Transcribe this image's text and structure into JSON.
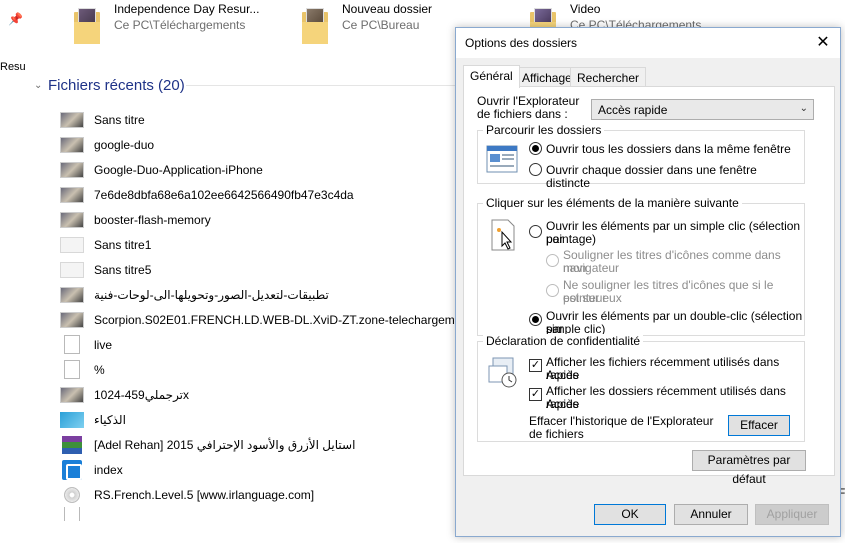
{
  "explorer": {
    "left_label": "Resu",
    "top_items": [
      {
        "name": "Independence Day Resur...",
        "location": "Ce PC\\Téléchargements"
      },
      {
        "name": "Nouveau dossier",
        "location": "Ce PC\\Bureau"
      },
      {
        "name": "Video",
        "location": "Ce PC\\Téléchargements"
      }
    ],
    "recent_header": "Fichiers récents (20)",
    "recent_files": [
      {
        "name": "Sans titre",
        "icon": "image-thumb-icon"
      },
      {
        "name": "google-duo",
        "icon": "image-thumb-icon"
      },
      {
        "name": "Google-Duo-Application-iPhone",
        "icon": "image-thumb-icon"
      },
      {
        "name": "7e6de8dbfa68e6a102ee6642566490fb47e3c4da",
        "icon": "image-thumb-icon"
      },
      {
        "name": "booster-flash-memory",
        "icon": "image-thumb-icon"
      },
      {
        "name": "Sans titre1",
        "icon": "blank-image-icon"
      },
      {
        "name": "Sans titre5",
        "icon": "blank-image-icon"
      },
      {
        "name": "تطبيقات-لتعديل-الصور-وتحويلها-الى-لوحات-فنية",
        "icon": "image-thumb-icon"
      },
      {
        "name": "Scorpion.S02E01.FRENCH.LD.WEB-DL.XviD-ZT.zone-telechargement.",
        "icon": "video-thumb-icon"
      },
      {
        "name": "live",
        "icon": "document-icon"
      },
      {
        "name": "%",
        "icon": "document-icon"
      },
      {
        "name": "1024-ترجملي459x",
        "icon": "image-thumb-icon"
      },
      {
        "name": "الذكياء",
        "icon": "tile-image-icon"
      },
      {
        "name": "[Adel Rehan] 2015 استايل الأزرق والأسود الإحترافي",
        "icon": "rar-archive-icon"
      },
      {
        "name": "index",
        "icon": "app-icon"
      },
      {
        "name": "RS.French.Level.5 [www.irlanguage.com]",
        "icon": "disc-image-icon"
      }
    ],
    "right_fragment": "F"
  },
  "dialog": {
    "title": "Options des dossiers",
    "close_symbol": "✕",
    "tabs": [
      "Général",
      "Affichage",
      "Rechercher"
    ],
    "open_explorer": {
      "label_line1": "Ouvrir l'Explorateur",
      "label_line2": "de fichiers dans :",
      "selected": "Accès rapide",
      "arrow": "⌄"
    },
    "browse_group": {
      "title": "Parcourir les dossiers",
      "options": [
        {
          "label": "Ouvrir tous les dossiers dans la même fenêtre",
          "checked": true
        },
        {
          "label": "Ouvrir chaque dossier dans une fenêtre distincte",
          "checked": false
        }
      ]
    },
    "click_group": {
      "title": "Cliquer sur les éléments de la manière suivante",
      "single_click_line1": "Ouvrir les éléments par un simple clic (sélection par",
      "single_click_line2": "pointage)",
      "underline_all_line1": "Souligner les titres d'icônes comme dans mon",
      "underline_all_line2": "navigateur",
      "underline_hover_line1": "Ne souligner les titres d'icônes que si le pointeur",
      "underline_hover_line2": "est sur eux",
      "double_click_line1": "Ouvrir les éléments par un double-clic (sélection par",
      "double_click_line2": "simple clic)",
      "selected": "double_click"
    },
    "privacy_group": {
      "title": "Déclaration de confidentialité",
      "show_recent_files_line1": "Afficher les fichiers récemment utilisés dans Accès",
      "show_recent_files_line2": "rapide",
      "show_recent_folders_line1": "Afficher les dossiers récemment utilisés dans Accès",
      "show_recent_folders_line2": "rapide",
      "clear_label_line1": "Effacer l'historique de l'Explorateur",
      "clear_label_line2": "de fichiers",
      "clear_button": "Effacer",
      "check_mark": "✓"
    },
    "restore_defaults": "Paramètres par défaut",
    "ok": "OK",
    "cancel": "Annuler",
    "apply": "Appliquer"
  }
}
